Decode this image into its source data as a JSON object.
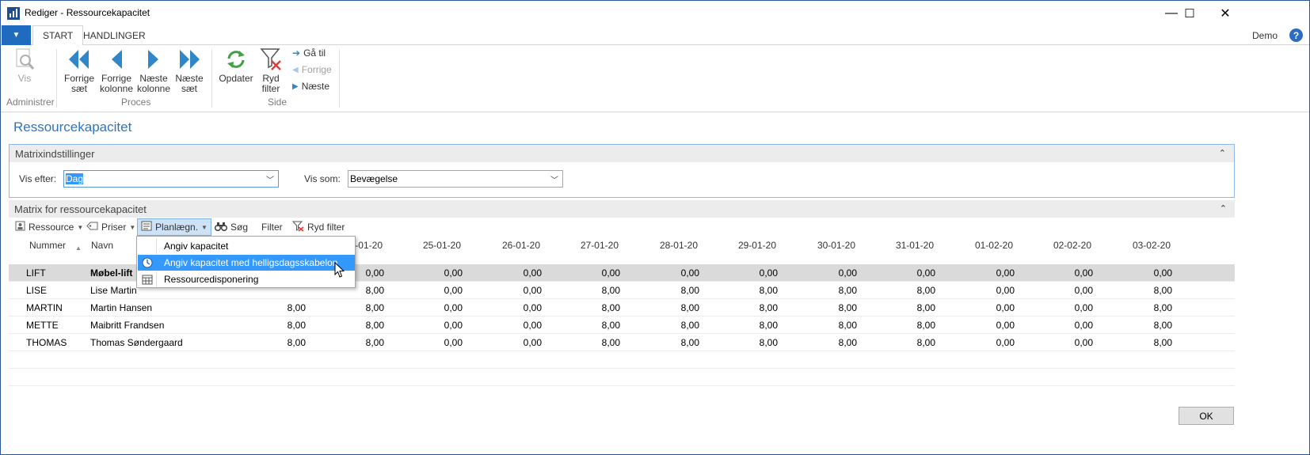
{
  "window": {
    "title": "Rediger - Ressourcekapacitet",
    "minimize": "—",
    "maximize": "☐",
    "close": "✕"
  },
  "ribbon_tabs": {
    "file_glyph": "▼",
    "tabs": [
      "START",
      "HANDLINGER"
    ],
    "user": "Demo",
    "help": "?"
  },
  "ribbon": {
    "administrer": {
      "label": "Administrer",
      "vis": "Vis"
    },
    "proces": {
      "label": "Proces",
      "buttons": [
        {
          "line1": "Forrige",
          "line2": "sæt"
        },
        {
          "line1": "Forrige",
          "line2": "kolonne"
        },
        {
          "line1": "Næste",
          "line2": "kolonne"
        },
        {
          "line1": "Næste",
          "line2": "sæt"
        }
      ]
    },
    "side": {
      "label": "Side",
      "opdater": "Opdater",
      "ryd_line1": "Ryd",
      "ryd_line2": "filter",
      "ga_til": "Gå til",
      "forrige": "Forrige",
      "naeste": "Næste"
    }
  },
  "page_title": "Ressourcekapacitet",
  "matrix_settings": {
    "header": "Matrixindstillinger",
    "vis_efter_label": "Vis efter:",
    "vis_efter_value": "Dag",
    "vis_som_label": "Vis som:",
    "vis_som_value": "Bevægelse"
  },
  "matrix": {
    "header": "Matrix for ressourcekapacitet",
    "actions": {
      "ressource": "Ressource",
      "priser": "Priser",
      "planlaegn": "Planlægn.",
      "sog": "Søg",
      "filter": "Filter",
      "ryd_filter": "Ryd filter"
    },
    "columns": {
      "nummer": "Nummer",
      "navn": "Navn",
      "dates": [
        "-01-20",
        "25-01-20",
        "26-01-20",
        "27-01-20",
        "28-01-20",
        "29-01-20",
        "30-01-20",
        "31-01-20",
        "01-02-20",
        "02-02-20",
        "03-02-20"
      ]
    },
    "rows": [
      {
        "nummer": "LIFT",
        "navn": "Møbel-lift",
        "values": [
          "0,00",
          "0,00",
          "0,00",
          "0,00",
          "0,00",
          "0,00",
          "0,00",
          "0,00",
          "0,00",
          "0,00",
          "0,00"
        ]
      },
      {
        "nummer": "LISE",
        "navn": "Lise Martin",
        "values": [
          "8,00",
          "0,00",
          "0,00",
          "8,00",
          "8,00",
          "8,00",
          "8,00",
          "8,00",
          "0,00",
          "0,00",
          "8,00"
        ]
      },
      {
        "nummer": "MARTIN",
        "navn": "Martin Hansen",
        "first": "8,00",
        "values": [
          "8,00",
          "0,00",
          "0,00",
          "8,00",
          "8,00",
          "8,00",
          "8,00",
          "8,00",
          "0,00",
          "0,00",
          "8,00"
        ]
      },
      {
        "nummer": "METTE",
        "navn": "Maibritt Frandsen",
        "first": "8,00",
        "values": [
          "8,00",
          "0,00",
          "0,00",
          "8,00",
          "8,00",
          "8,00",
          "8,00",
          "8,00",
          "0,00",
          "0,00",
          "8,00"
        ]
      },
      {
        "nummer": "THOMAS",
        "navn": "Thomas Søndergaard",
        "first": "8,00",
        "values": [
          "8,00",
          "0,00",
          "0,00",
          "8,00",
          "8,00",
          "8,00",
          "8,00",
          "8,00",
          "0,00",
          "0,00",
          "8,00"
        ]
      }
    ]
  },
  "menu": {
    "items": [
      "Angiv kapacitet",
      "Angiv kapacitet med helligsdagsskabelon",
      "Ressourcedisponering"
    ]
  },
  "ok": "OK"
}
